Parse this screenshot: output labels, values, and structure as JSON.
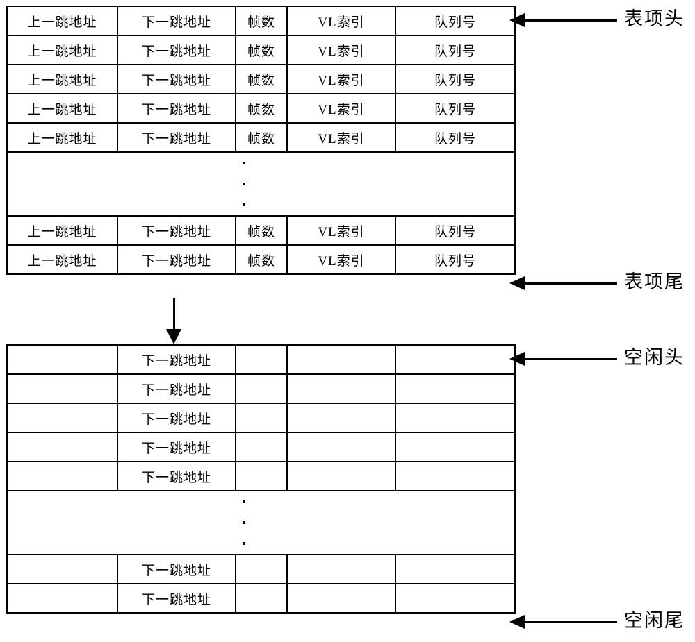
{
  "diagram": {
    "columns": {
      "prev_hop": "上一跳地址",
      "next_hop": "下一跳地址",
      "frame_count": "帧数",
      "vl_index": "VL索引",
      "queue_id": "队列号",
      "blank": ""
    },
    "entry_table": {
      "rows_top": [
        {
          "c1": "上一跳地址",
          "c2": "下一跳地址",
          "c3": "帧数",
          "c4": "VL索引",
          "c5": "队列号"
        },
        {
          "c1": "上一跳地址",
          "c2": "下一跳地址",
          "c3": "帧数",
          "c4": "VL索引",
          "c5": "队列号"
        },
        {
          "c1": "上一跳地址",
          "c2": "下一跳地址",
          "c3": "帧数",
          "c4": "VL索引",
          "c5": "队列号"
        },
        {
          "c1": "上一跳地址",
          "c2": "下一跳地址",
          "c3": "帧数",
          "c4": "VL索引",
          "c5": "队列号"
        },
        {
          "c1": "上一跳地址",
          "c2": "下一跳地址",
          "c3": "帧数",
          "c4": "VL索引",
          "c5": "队列号"
        }
      ],
      "ellipsis": "⋮",
      "rows_bottom": [
        {
          "c1": "上一跳地址",
          "c2": "下一跳地址",
          "c3": "帧数",
          "c4": "VL索引",
          "c5": "队列号"
        },
        {
          "c1": "上一跳地址",
          "c2": "下一跳地址",
          "c3": "帧数",
          "c4": "VL索引",
          "c5": "队列号"
        }
      ]
    },
    "free_table": {
      "rows_top": [
        {
          "c1": "",
          "c2": "下一跳地址",
          "c3": "",
          "c4": "",
          "c5": ""
        },
        {
          "c1": "",
          "c2": "下一跳地址",
          "c3": "",
          "c4": "",
          "c5": ""
        },
        {
          "c1": "",
          "c2": "下一跳地址",
          "c3": "",
          "c4": "",
          "c5": ""
        },
        {
          "c1": "",
          "c2": "下一跳地址",
          "c3": "",
          "c4": "",
          "c5": ""
        },
        {
          "c1": "",
          "c2": "下一跳地址",
          "c3": "",
          "c4": "",
          "c5": ""
        }
      ],
      "ellipsis": "⋮",
      "rows_bottom": [
        {
          "c1": "",
          "c2": "下一跳地址",
          "c3": "",
          "c4": "",
          "c5": ""
        },
        {
          "c1": "",
          "c2": "下一跳地址",
          "c3": "",
          "c4": "",
          "c5": ""
        }
      ]
    },
    "annotations": {
      "entry_head": "表项头",
      "entry_tail": "表项尾",
      "free_head": "空闲头",
      "free_tail": "空闲尾"
    },
    "colors": {
      "line": "#000000",
      "background": "#ffffff",
      "text": "#000000"
    }
  }
}
